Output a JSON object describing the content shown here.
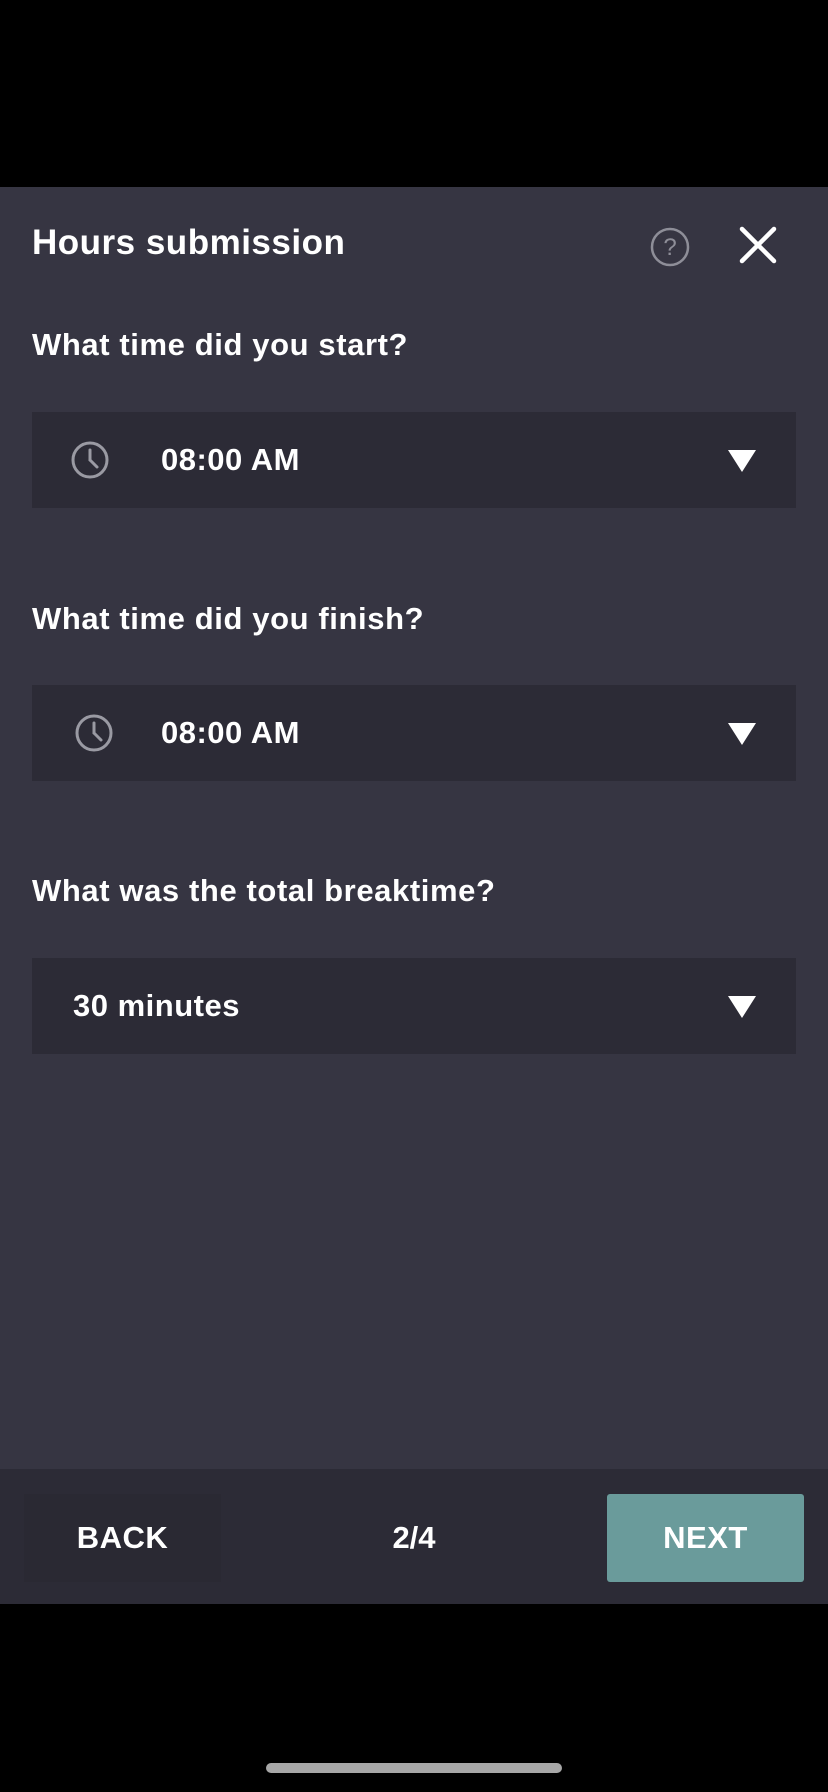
{
  "header": {
    "title": "Hours submission",
    "help_icon": "question-circle-icon",
    "close_icon": "close-icon"
  },
  "form": {
    "start": {
      "question": "What time did you start?",
      "value": "08:00 AM",
      "icon": "clock-icon"
    },
    "finish": {
      "question": "What time did you finish?",
      "value": "08:00 AM",
      "icon": "clock-icon"
    },
    "break": {
      "question": "What was the total breaktime?",
      "value": "30 minutes"
    }
  },
  "footer": {
    "back_label": "BACK",
    "step": "2/4",
    "next_label": "NEXT"
  },
  "colors": {
    "sheet_bg": "#363542",
    "field_bg": "#2c2b36",
    "accent": "#6a9b9b"
  }
}
